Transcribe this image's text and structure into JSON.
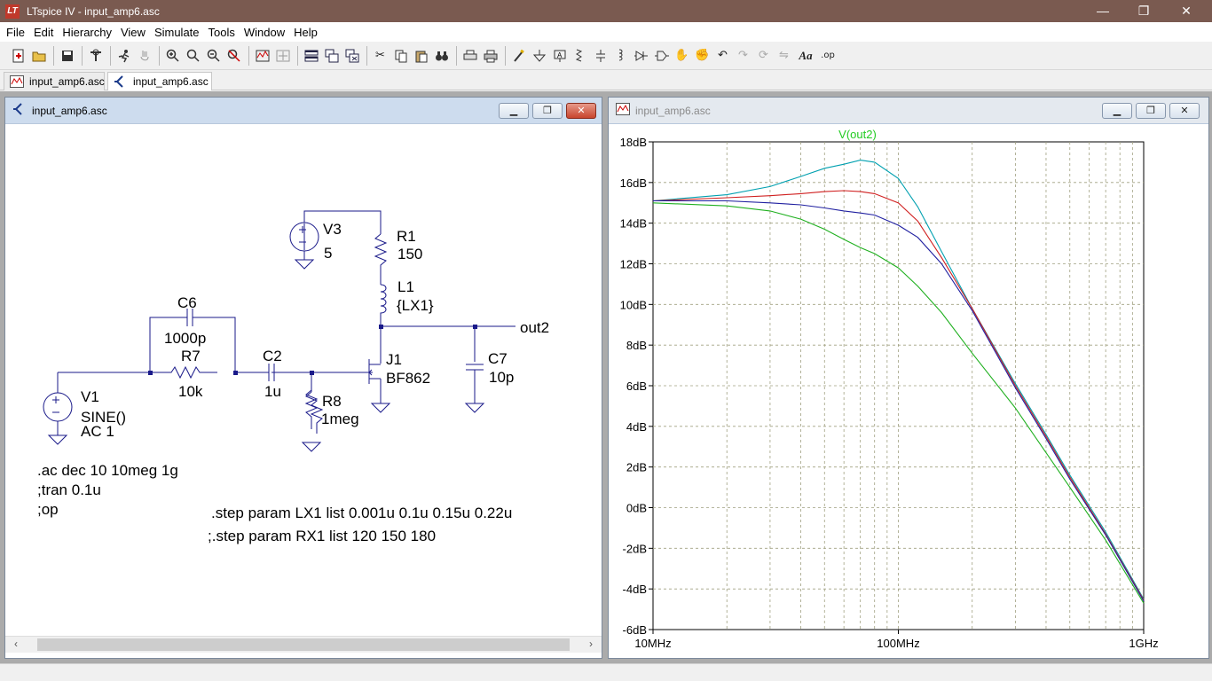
{
  "window": {
    "title": "LTspice IV - input_amp6.asc",
    "app_icon": "LT",
    "minimize": "—",
    "maximize": "❐",
    "close": "✕"
  },
  "menu": [
    "File",
    "Edit",
    "Hierarchy",
    "View",
    "Simulate",
    "Tools",
    "Window",
    "Help"
  ],
  "toolbar": {
    "icons": [
      "new-schematic-icon",
      "open-icon",
      "save-icon",
      "control-panel-icon",
      "run-icon",
      "halt-icon",
      "zoom-in-icon",
      "zoom-pan-icon",
      "zoom-out-icon",
      "zoom-cancel-icon",
      "autorange-icon",
      "plot-settings-icon",
      "tile-icon",
      "cascade-icon",
      "close-all-icon",
      "cut-icon",
      "copy-icon",
      "paste-icon",
      "find-icon",
      "print-preview-icon",
      "print-icon",
      "wire-icon",
      "ground-icon",
      "label-icon",
      "resistor-icon",
      "capacitor-icon",
      "inductor-icon",
      "diode-icon",
      "component-icon",
      "move-icon",
      "drag-icon",
      "undo-icon",
      "redo-icon",
      "rotate-icon",
      "mirror-icon",
      "text-icon",
      "spice-directive-icon"
    ],
    "text_label": "Aa",
    "op_label": ".op"
  },
  "tabs": [
    {
      "label": "input_amp6.asc",
      "icon": "waveform-icon"
    },
    {
      "label": "input_amp6.asc",
      "icon": "schematic-icon"
    }
  ],
  "schematic": {
    "title": "input_amp6.asc",
    "components": {
      "v3_name": "V3",
      "v3_value": "5",
      "r1_name": "R1",
      "r1_value": "150",
      "l1_name": "L1",
      "l1_value": "{LX1}",
      "c6_name": "C6",
      "c6_value": "1000p",
      "r7_name": "R7",
      "r7_value": "10k",
      "c2_name": "C2",
      "c2_value": "1u",
      "j1_name": "J1",
      "j1_value": "BF862",
      "c7_name": "C7",
      "c7_value": "10p",
      "r8_name": "R8",
      "r8_value": "1meg",
      "v1_name": "V1",
      "v1_value1": "SINE()",
      "v1_value2": "AC 1",
      "out_label": "out2"
    },
    "directives": [
      ".ac dec 10 10meg 1g",
      ";tran 0.1u",
      ";op"
    ],
    "step_directives": [
      ".step param LX1 list 0.001u 0.1u  0.15u 0.22u",
      ";.step param RX1 list 120 150 180"
    ]
  },
  "waveform": {
    "title": "input_amp6.asc"
  },
  "chart_data": {
    "type": "line",
    "title": "V(out2)",
    "xscale": "log",
    "xlim": [
      10000000,
      1000000000
    ],
    "ylim": [
      -6,
      18
    ],
    "grid": true,
    "x_tick_labels": [
      "10MHz",
      "100MHz",
      "1GHz"
    ],
    "y_tick_labels": [
      "18dB",
      "16dB",
      "14dB",
      "12dB",
      "10dB",
      "8dB",
      "6dB",
      "4dB",
      "2dB",
      "0dB",
      "-2dB",
      "-4dB",
      "-6dB"
    ],
    "y_ticks": [
      18,
      16,
      14,
      12,
      10,
      8,
      6,
      4,
      2,
      0,
      -2,
      -4,
      -6
    ],
    "title_color": "#22cc22",
    "x": [
      10000000,
      20000000,
      30000000,
      40000000,
      50000000,
      60000000,
      70000000,
      80000000,
      100000000,
      120000000,
      150000000,
      200000000,
      300000000,
      400000000,
      500000000,
      700000000,
      1000000000
    ],
    "series": [
      {
        "color": "#00a0b0",
        "values": [
          15.1,
          15.4,
          15.8,
          16.3,
          16.7,
          16.9,
          17.1,
          17.0,
          16.2,
          14.8,
          12.6,
          9.8,
          6.1,
          3.6,
          1.6,
          -1.2,
          -4.5
        ]
      },
      {
        "color": "#d02020",
        "values": [
          15.1,
          15.25,
          15.35,
          15.45,
          15.55,
          15.6,
          15.55,
          15.45,
          15.0,
          14.1,
          12.3,
          9.8,
          6.0,
          3.5,
          1.5,
          -1.3,
          -4.55
        ]
      },
      {
        "color": "#2020a0",
        "values": [
          15.1,
          15.1,
          15.0,
          14.9,
          14.75,
          14.6,
          14.5,
          14.4,
          13.9,
          13.3,
          12.0,
          9.7,
          5.9,
          3.4,
          1.4,
          -1.35,
          -4.6
        ]
      },
      {
        "color": "#20b020",
        "values": [
          15.0,
          14.85,
          14.6,
          14.2,
          13.7,
          13.2,
          12.8,
          12.5,
          11.8,
          10.9,
          9.6,
          7.6,
          4.9,
          2.7,
          1.0,
          -1.6,
          -4.7
        ]
      }
    ]
  }
}
